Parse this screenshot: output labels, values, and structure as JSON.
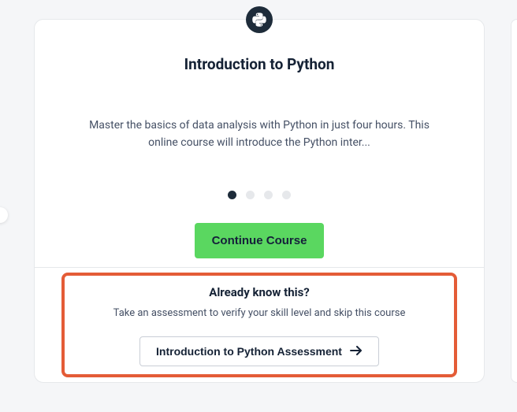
{
  "course": {
    "title": "Introduction to Python",
    "description": "Master the basics of data analysis with Python in just four hours. This online course will introduce the Python inter...",
    "continue_label": "Continue Course",
    "icon_name": "python-icon"
  },
  "carousel": {
    "total_dots": 4,
    "active_index": 0
  },
  "assessment": {
    "heading": "Already know this?",
    "subtext": "Take an assessment to verify your skill level and skip this course",
    "button_label": "Introduction to Python Assessment"
  },
  "colors": {
    "accent_green": "#5ad760",
    "highlight_orange": "#e45c37",
    "text_dark": "#152235"
  }
}
